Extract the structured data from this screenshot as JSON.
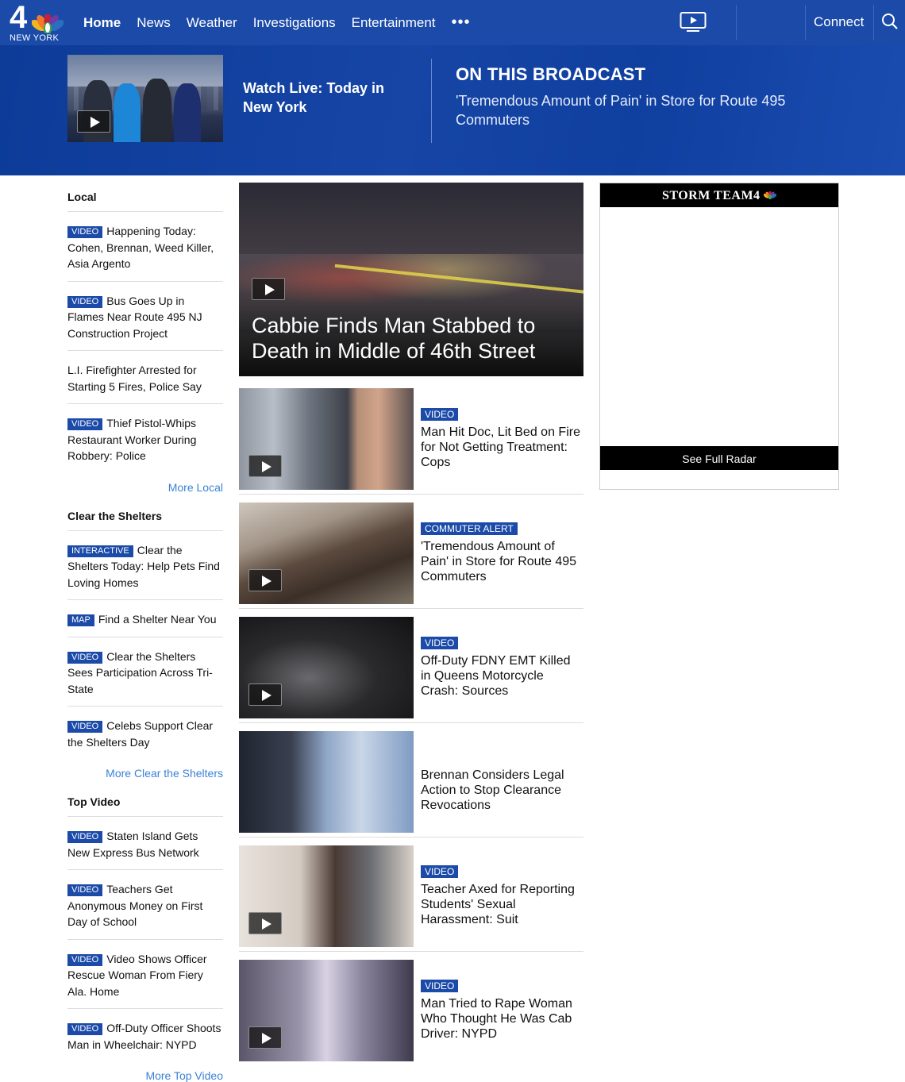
{
  "brand": {
    "logo_number": "4",
    "city": "NEW YORK"
  },
  "nav": {
    "links": [
      "Home",
      "News",
      "Weather",
      "Investigations",
      "Entertainment"
    ],
    "more": "•••",
    "connect": "Connect"
  },
  "banner": {
    "watch_live": "Watch Live: Today in New York",
    "section_title": "ON THIS BROADCAST",
    "story": "'Tremendous Amount of Pain' in Store for Route 495 Commuters"
  },
  "sidebar": {
    "sections": [
      {
        "title": "Local",
        "items": [
          {
            "tag": "VIDEO",
            "text": "Happening Today: Cohen, Brennan, Weed Killer, Asia Argento"
          },
          {
            "tag": "VIDEO",
            "text": "Bus Goes Up in Flames Near Route 495 NJ Construction Project"
          },
          {
            "tag": "",
            "text": "L.I. Firefighter Arrested for Starting 5 Fires, Police Say"
          },
          {
            "tag": "VIDEO",
            "text": "Thief Pistol-Whips Restaurant Worker During Robbery: Police"
          }
        ],
        "more": "More Local"
      },
      {
        "title": "Clear the Shelters",
        "items": [
          {
            "tag": "INTERACTIVE",
            "text": "Clear the Shelters Today: Help Pets Find Loving Homes"
          },
          {
            "tag": "MAP",
            "text": "Find a Shelter Near You"
          },
          {
            "tag": "VIDEO",
            "text": "Clear the Shelters Sees Participation Across Tri-State"
          },
          {
            "tag": "VIDEO",
            "text": "Celebs Support Clear the Shelters Day"
          }
        ],
        "more": "More Clear the Shelters"
      },
      {
        "title": "Top Video",
        "items": [
          {
            "tag": "VIDEO",
            "text": "Staten Island Gets New Express Bus Network"
          },
          {
            "tag": "VIDEO",
            "text": "Teachers Get Anonymous Money on First Day of School"
          },
          {
            "tag": "VIDEO",
            "text": "Video Shows Officer Rescue Woman From Fiery Ala. Home"
          },
          {
            "tag": "VIDEO",
            "text": "Off-Duty Officer Shoots Man in Wheelchair: NYPD"
          }
        ],
        "more": "More Top Video"
      }
    ]
  },
  "hero": {
    "title": "Cabbie Finds Man Stabbed to Death in Middle of 46th Street"
  },
  "stories": [
    {
      "tag": "VIDEO",
      "title": "Man Hit Doc, Lit Bed on Fire for Not Getting Treatment: Cops"
    },
    {
      "tag": "COMMUTER ALERT",
      "title": "'Tremendous Amount of Pain' in Store for Route 495 Commuters"
    },
    {
      "tag": "VIDEO",
      "title": "Off-Duty FDNY EMT Killed in Queens Motorcycle Crash: Sources"
    },
    {
      "tag": "",
      "title": "Brennan Considers Legal Action to Stop Clearance Revocations"
    },
    {
      "tag": "VIDEO",
      "title": "Teacher Axed for Reporting Students' Sexual Harassment: Suit"
    },
    {
      "tag": "VIDEO",
      "title": "Man Tried to Rape Woman Who Thought He Was Cab Driver: NYPD"
    }
  ],
  "weather": {
    "title": "STORM TEAM",
    "title_number": "4",
    "button": "See Full Radar"
  },
  "colors": {
    "nav": "#1b4aa8",
    "tag": "#1b4aa8",
    "link": "#3b82d6"
  }
}
